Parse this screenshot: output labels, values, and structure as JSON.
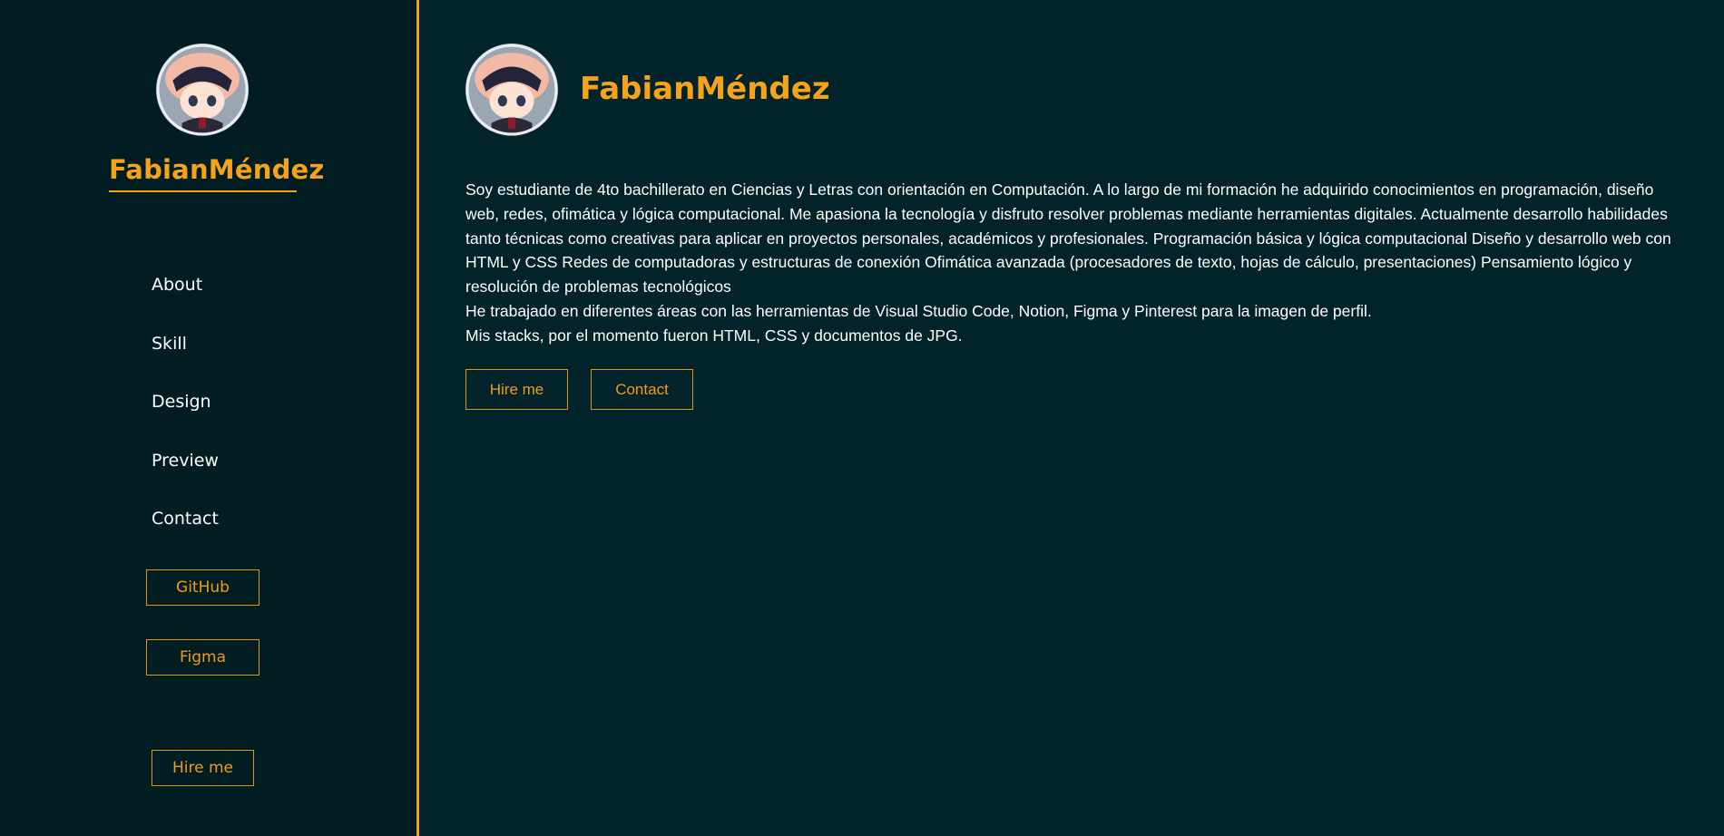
{
  "sidebar": {
    "brand": "FabianMéndez",
    "nav": [
      {
        "label": "About"
      },
      {
        "label": "Skill"
      },
      {
        "label": "Design"
      },
      {
        "label": "Preview"
      },
      {
        "label": "Contact"
      }
    ],
    "github_label": "GitHub",
    "figma_label": "Figma",
    "hire_label": "Hire me"
  },
  "main": {
    "title": "FabianMéndez",
    "bio": [
      "Soy estudiante de 4to bachillerato en Ciencias y Letras con orientación en Computación. A lo largo de mi formación he adquirido conocimientos en programación, diseño web, redes, ofimática y lógica computacional. Me apasiona la tecnología y disfruto resolver problemas mediante herramientas digitales. Actualmente desarrollo habilidades tanto técnicas como creativas para aplicar en proyectos personales, académicos y profesionales. Programación básica y lógica computacional Diseño y desarrollo web con HTML y CSS Redes de computadoras y estructuras de conexión Ofimática avanzada (procesadores de texto, hojas de cálculo, presentaciones) Pensamiento lógico y resolución de problemas tecnológicos",
      "He trabajado en diferentes áreas con las herramientas de Visual Studio Code, Notion, Figma y Pinterest para la imagen de perfil.",
      "Mis stacks, por el momento fueron HTML, CSS y documentos de JPG."
    ],
    "hire_label": "Hire me",
    "contact_label": "Contact"
  },
  "colors": {
    "background": "#02232a",
    "sidebar_background": "#021d22",
    "accent": "#f5a319",
    "text": "#ffffff"
  },
  "icons": {
    "avatar": "avatar-chibi-icon"
  }
}
